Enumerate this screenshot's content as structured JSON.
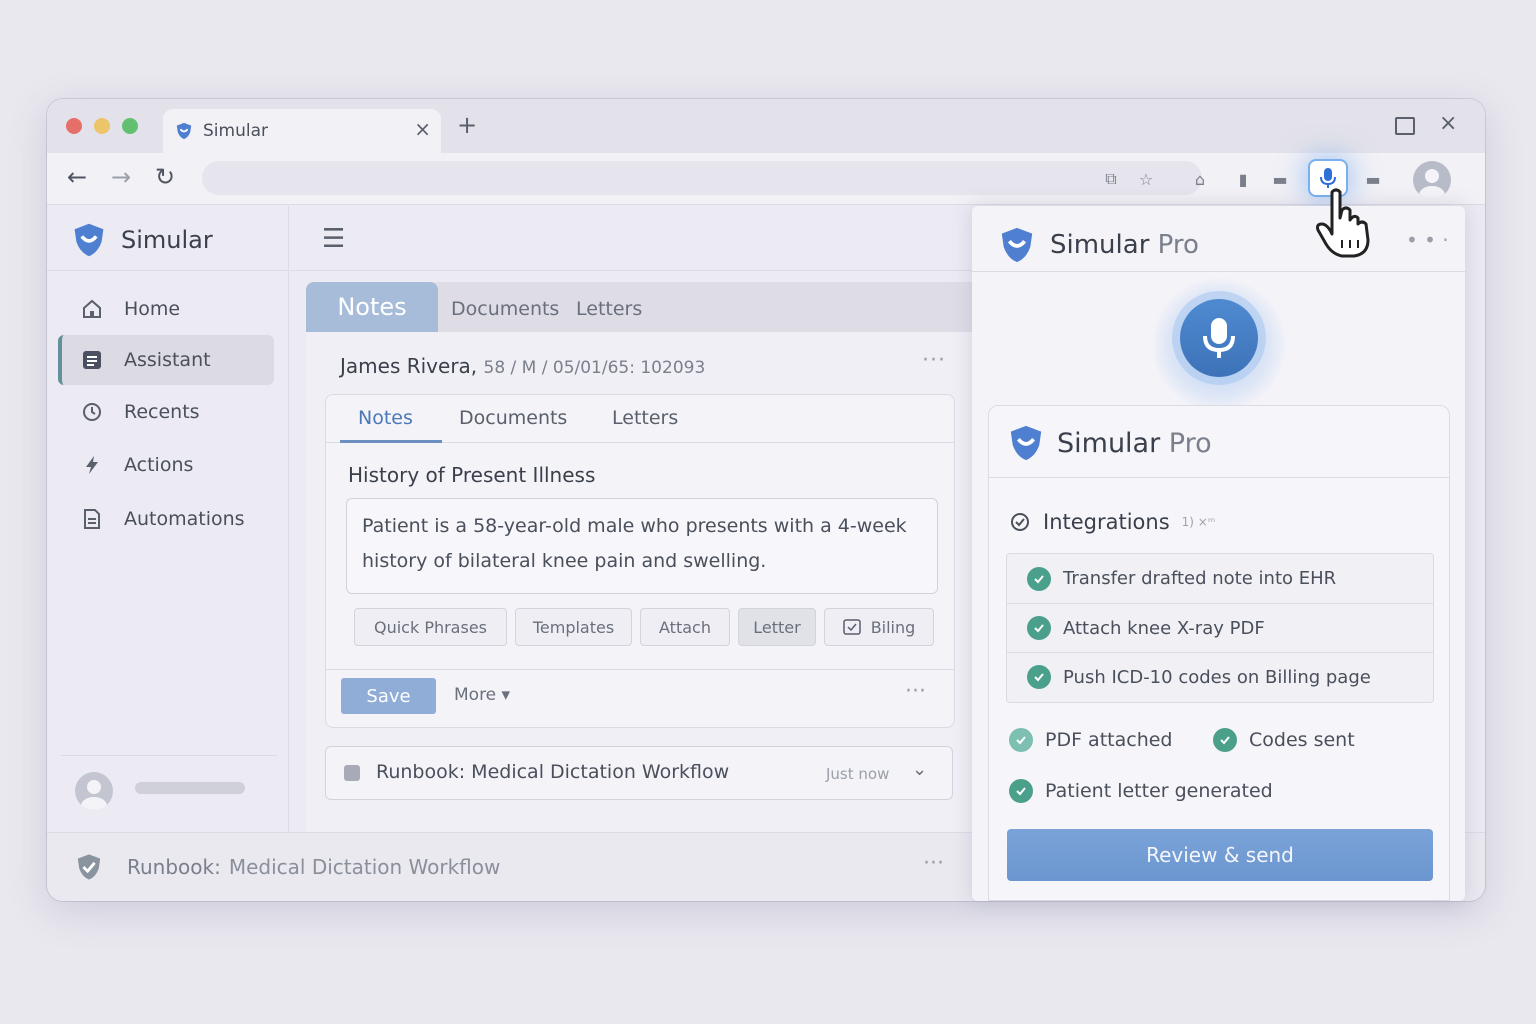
{
  "browser": {
    "tab_title": "Simular",
    "new_tab_label": "+",
    "close_label": "×"
  },
  "sidebar": {
    "brand": "Simular",
    "items": [
      {
        "label": "Home",
        "icon": "home-icon"
      },
      {
        "label": "Assistant",
        "icon": "assistant-icon"
      },
      {
        "label": "Recents",
        "icon": "clock-icon"
      },
      {
        "label": "Actions",
        "icon": "bolt-icon"
      },
      {
        "label": "Automations",
        "icon": "document-icon"
      }
    ]
  },
  "main": {
    "outer_tabs": [
      "Notes",
      "Documents",
      "Letters"
    ],
    "patient": {
      "name": "James Rivera,",
      "meta": "58 / M / 05/01/65: 102093"
    },
    "inner_tabs": [
      "Notes",
      "Documents",
      "Letters"
    ],
    "section_title": "History of Present Illness",
    "hpi_text": "Patient is a 58-year-old male who presents with a 4-week history of bilateral knee pain and swelling.",
    "chips": [
      "Quick Phrases",
      "Templates",
      "Attach",
      "Letter",
      "Biling"
    ],
    "save_label": "Save",
    "more_label": "More ▾",
    "runbook": {
      "title": "Runbook: Medical Dictation Workflow",
      "time": "Just now"
    }
  },
  "statusbar": {
    "prefix": "Runbook:",
    "label": "Medical Dictation Workflow"
  },
  "panel": {
    "brand": "Simular",
    "brand_suffix": "Pro",
    "sub_brand": "Simular",
    "sub_brand_suffix": "Pro",
    "integrations_title": "Integrations",
    "integrations_sup": "1) ×ᵐ",
    "tasks": [
      "Transfer drafted note into EHR",
      "Attach knee X-ray PDF",
      "Push ICD-10 codes on Billing page"
    ],
    "statuses": [
      "PDF attached",
      "Codes sent",
      "Patient letter generated"
    ],
    "review_label": "Review & send"
  },
  "colors": {
    "accent": "#4a78b8",
    "brand_shield": "#4f7fd0",
    "success": "#4aa08a",
    "primary_button": "#6c96cf"
  }
}
